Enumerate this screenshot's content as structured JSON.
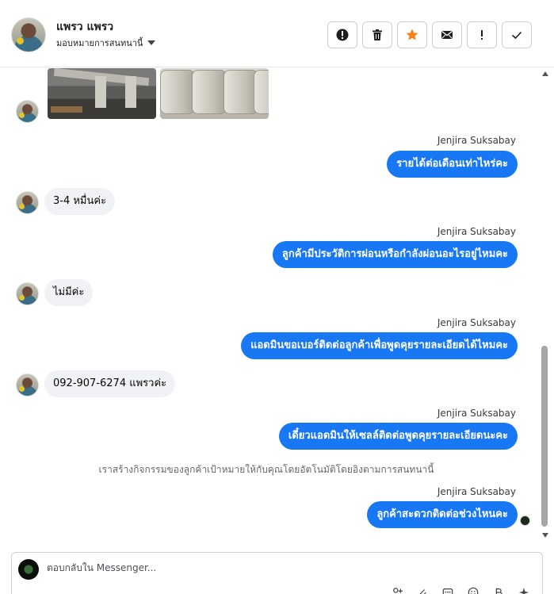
{
  "header": {
    "contact_name": "แพรว แพรว",
    "assign_label": "มอบหมายการสนทนานี้",
    "toolbar": [
      {
        "name": "report-spam-button",
        "icon": "exclamation-circle-icon"
      },
      {
        "name": "delete-button",
        "icon": "trash-icon"
      },
      {
        "name": "star-button",
        "icon": "star-icon"
      },
      {
        "name": "mark-unread-button",
        "icon": "envelope-icon"
      },
      {
        "name": "follow-up-button",
        "icon": "exclamation-icon"
      },
      {
        "name": "mark-done-button",
        "icon": "check-icon"
      }
    ]
  },
  "messages": {
    "m1": {
      "sender": "Jenjira Suksabay",
      "text": "รายได้ต่อเดือนเท่าไหร่คะ"
    },
    "m2": {
      "text": "3-4 หมื่นค่ะ"
    },
    "m3": {
      "sender": "Jenjira Suksabay",
      "text": "ลูกค้ามีประวัติการผ่อนหรือกำลังผ่อนอะไรอยู่ไหมคะ"
    },
    "m4": {
      "text": "ไม่มีค่ะ"
    },
    "m5": {
      "sender": "Jenjira Suksabay",
      "text": "แอดมินขอเบอร์ติดต่อลูกค้าเพื่อพูดคุยรายละเอียดได้ไหมคะ"
    },
    "m6": {
      "text": "092-907-6274 แพรวค่ะ"
    },
    "m7": {
      "sender": "Jenjira Suksabay",
      "text": "เดี๋ยวแอดมินให้เซลล์ติดต่อพูดคุยรายละเอียดนะคะ"
    },
    "system": "เราสร้างกิจกรรมของลูกค้าเป้าหมายให้กับคุณโดยอัตโนมัติโดยอิงตามการสนทนานี้",
    "m8": {
      "sender": "Jenjira Suksabay",
      "text": "ลูกค้าสะดวกติดต่อช่วงไหนคะ"
    }
  },
  "composer": {
    "placeholder": "ตอบกลับใน Messenger..."
  },
  "colors": {
    "outgoing_bubble": "#1877f2",
    "incoming_bubble": "#f0f2f5",
    "star": "#f5821f"
  }
}
